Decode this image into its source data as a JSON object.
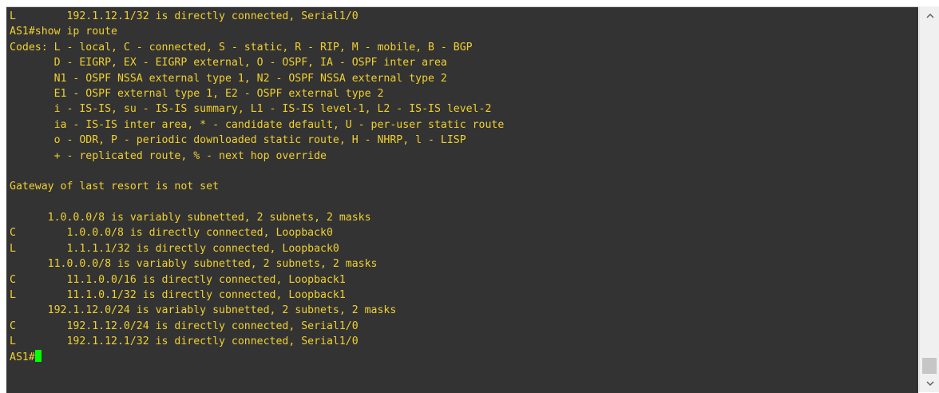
{
  "terminal": {
    "text_color": "#f0d030",
    "background": "#333333",
    "cursor_color": "#00ff00",
    "lines": [
      "L        192.1.12.1/32 is directly connected, Serial1/0",
      "AS1#show ip route",
      "Codes: L - local, C - connected, S - static, R - RIP, M - mobile, B - BGP",
      "       D - EIGRP, EX - EIGRP external, O - OSPF, IA - OSPF inter area",
      "       N1 - OSPF NSSA external type 1, N2 - OSPF NSSA external type 2",
      "       E1 - OSPF external type 1, E2 - OSPF external type 2",
      "       i - IS-IS, su - IS-IS summary, L1 - IS-IS level-1, L2 - IS-IS level-2",
      "       ia - IS-IS inter area, * - candidate default, U - per-user static route",
      "       o - ODR, P - periodic downloaded static route, H - NHRP, l - LISP",
      "       + - replicated route, % - next hop override",
      "",
      "Gateway of last resort is not set",
      "",
      "      1.0.0.0/8 is variably subnetted, 2 subnets, 2 masks",
      "C        1.0.0.0/8 is directly connected, Loopback0",
      "L        1.1.1.1/32 is directly connected, Loopback0",
      "      11.0.0.0/8 is variably subnetted, 2 subnets, 2 masks",
      "C        11.1.0.0/16 is directly connected, Loopback1",
      "L        11.1.0.1/32 is directly connected, Loopback1",
      "      192.1.12.0/24 is variably subnetted, 2 subnets, 2 masks",
      "C        192.1.12.0/24 is directly connected, Serial1/0",
      "L        192.1.12.1/32 is directly connected, Serial1/0"
    ],
    "prompt": "AS1#"
  },
  "scrollbar": {
    "up_icon": "chevron-up-icon",
    "down_icon": "chevron-down-icon"
  }
}
